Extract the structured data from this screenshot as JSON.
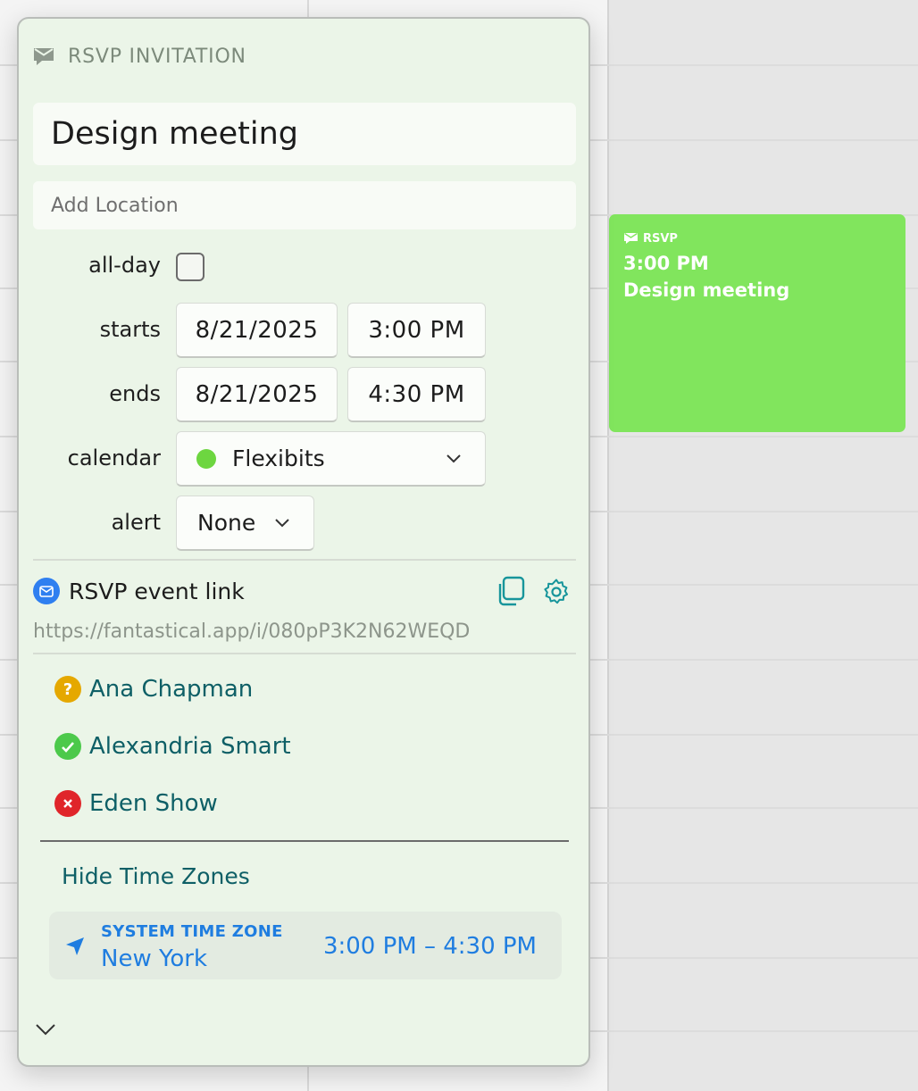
{
  "calendar_event": {
    "badge": "RSVP",
    "time": "3:00 PM",
    "title": "Design meeting",
    "color": "#81e55d"
  },
  "popover": {
    "header_label": "RSVP INVITATION",
    "header_icon": "rsvp-envelope-icon",
    "title": "Design meeting",
    "location_placeholder": "Add Location",
    "location_value": "",
    "allday": {
      "label": "all-day",
      "checked": false
    },
    "starts": {
      "label": "starts",
      "date": "8/21/2025",
      "time": "3:00  PM"
    },
    "ends": {
      "label": "ends",
      "date": "8/21/2025",
      "time": "4:30  PM"
    },
    "calendar": {
      "label": "calendar",
      "value": "Flexibits",
      "color": "#6dd640"
    },
    "alert": {
      "label": "alert",
      "value": "None"
    },
    "rsvp": {
      "label": "RSVP event link",
      "url": "https://fantastical.app/i/080pP3K2N62WEQD",
      "icon_color": "#2f7ff0",
      "actions": [
        "copy-icon",
        "gear-icon"
      ]
    },
    "attendees": [
      {
        "name": "Ana Chapman",
        "status": "pending",
        "color": "#e5a800"
      },
      {
        "name": "Alexandria Smart",
        "status": "accepted",
        "color": "#4cc94b"
      },
      {
        "name": "Eden Show",
        "status": "declined",
        "color": "#e0252a"
      }
    ],
    "hide_time_zones": "Hide Time Zones",
    "time_zone": {
      "caption": "SYSTEM TIME ZONE",
      "city": "New York",
      "range": "3:00 PM – 4:30 PM"
    },
    "accent_color": "#0e5f66",
    "link_color": "#1f7de0"
  }
}
